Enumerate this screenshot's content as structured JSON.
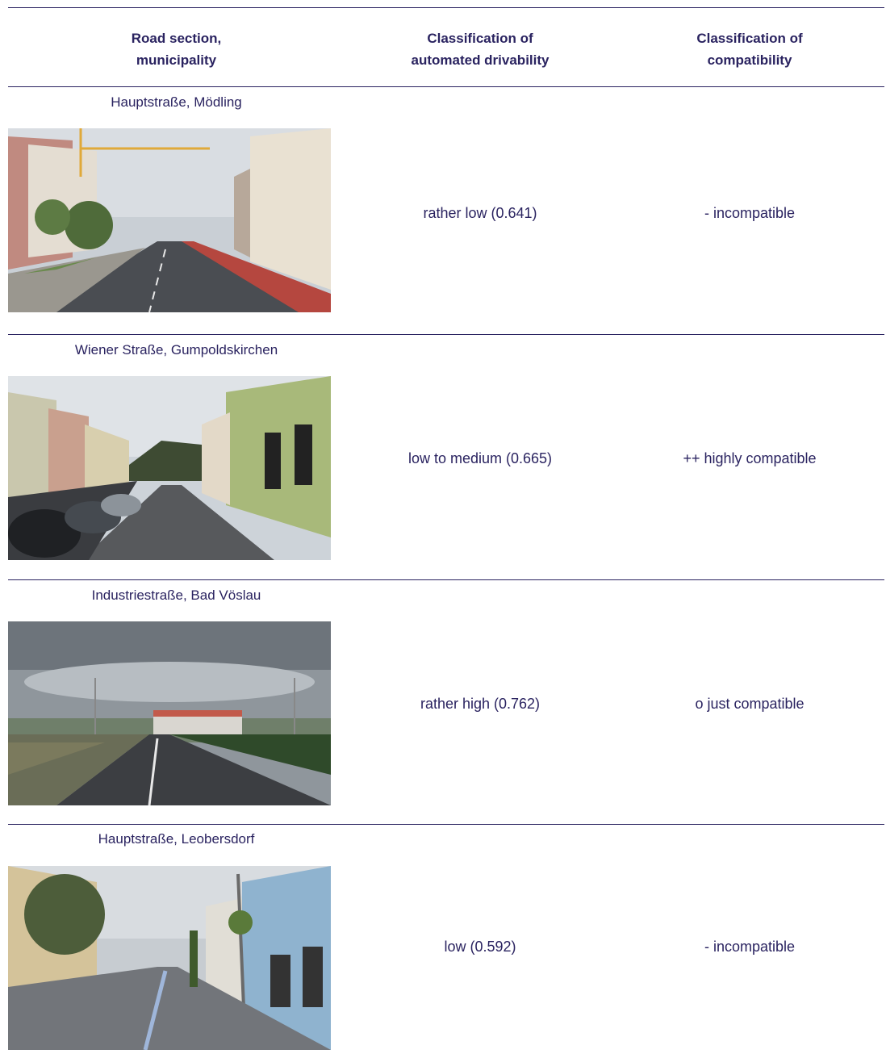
{
  "header": {
    "col1": [
      "Road section,",
      "municipality"
    ],
    "col2": [
      "Classification of",
      "automated drivability"
    ],
    "col3": [
      "Classification of",
      "compatibility"
    ]
  },
  "rows": [
    {
      "title": "Hauptstraße, Mödling",
      "drivability": "rather low (0.641)",
      "compatibility": "- incompatible"
    },
    {
      "title": "Wiener Straße, Gumpoldskirchen",
      "drivability": "low to medium (0.665)",
      "compatibility": "++ highly compatible"
    },
    {
      "title": "Industriestraße, Bad Vöslau",
      "drivability": "rather high (0.762)",
      "compatibility": "o just compatible"
    },
    {
      "title": "Hauptstraße, Leobersdorf",
      "drivability": "low (0.592)",
      "compatibility": "- incompatible"
    }
  ],
  "colors": {
    "text": "#2a2360",
    "rule": "#2a2360"
  }
}
